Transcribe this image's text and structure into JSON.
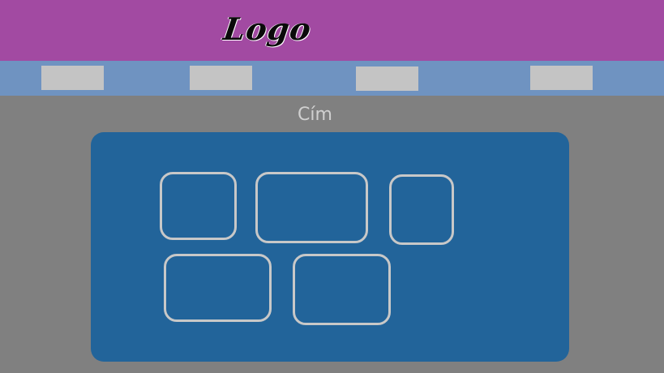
{
  "header": {
    "logo_text": "Logo",
    "background_color": "#a24aa2"
  },
  "nav": {
    "background_color": "#6f93c1",
    "items": [
      {
        "label": ""
      },
      {
        "label": ""
      },
      {
        "label": ""
      },
      {
        "label": ""
      }
    ]
  },
  "main": {
    "title": "Cím",
    "panel_color": "#22649a",
    "cards": [
      {
        "label": ""
      },
      {
        "label": ""
      },
      {
        "label": ""
      },
      {
        "label": ""
      },
      {
        "label": ""
      }
    ]
  },
  "colors": {
    "page_background": "#808080",
    "nav_item": "#c4c4c4",
    "card_border": "#c8c8c8"
  }
}
